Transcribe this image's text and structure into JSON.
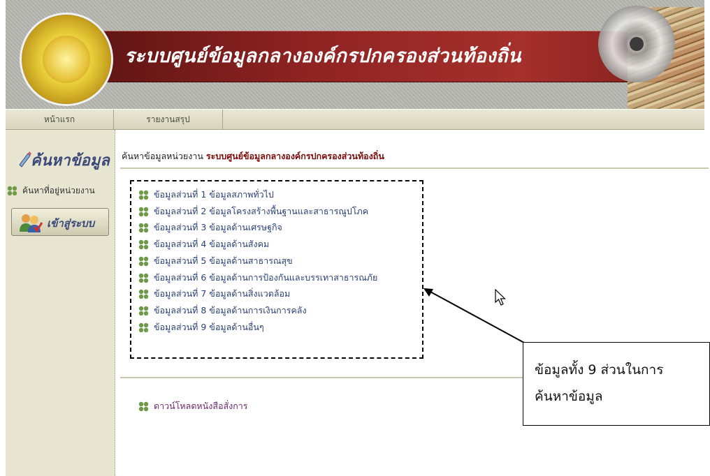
{
  "banner": {
    "title": "ระบบศูนย์ข้อมูลกลางองค์กรปกครองส่วนท้องถิ่น",
    "logo_icon": "department-of-local-administration-seal"
  },
  "nav": {
    "items": [
      {
        "label": "หน้าแรก"
      },
      {
        "label": "รายงานสรุป"
      }
    ]
  },
  "sidebar": {
    "search_title": "ค้นหาข้อมูล",
    "address_link": "ค้นหาที่อยู่หน่วยงาน",
    "login_label": "เข้าสู่ระบบ"
  },
  "content": {
    "header_prefix": "ค้นหาข้อมูลหน่วยงาน",
    "header_system": "ระบบศูนย์ข้อมูลกลางองค์กรปกครองส่วนท้องถิ่น",
    "items": [
      "ข้อมูลส่วนที่ 1 ข้อมูลสภาพทั่วไป",
      "ข้อมูลส่วนที่ 2 ข้อมูลโครงสร้างพื้นฐานและสาธารณูปโภค",
      "ข้อมูลส่วนที่ 3 ข้อมูลด้านเศรษฐกิจ",
      "ข้อมูลส่วนที่ 4 ข้อมูลด้านสังคม",
      "ข้อมูลส่วนที่ 5 ข้อมูลด้านสาธารณสุข",
      "ข้อมูลส่วนที่ 6 ข้อมูลด้านการป้องกันและบรรเทาสาธารณภัย",
      "ข้อมูลส่วนที่ 7 ข้อมูลด้านสิ่งแวดล้อม",
      "ข้อมูลส่วนที่ 8 ข้อมูลด้านการเงินการคลัง",
      "ข้อมูลส่วนที่ 9 ข้อมูลด้านอื่นๆ"
    ],
    "download_link": "ดาวน์โหลดหนังสือสั่งการ"
  },
  "annotation": {
    "line1": "ข้อมูลทั้ง 9 ส่วนในการ",
    "line2": "ค้นหาข้อมูล"
  },
  "colors": {
    "banner_red": "#8e2322",
    "sidebar_bg": "#e8e6d2",
    "link_blue": "#2a3f73",
    "bullet_green": "#5c8a3a"
  }
}
